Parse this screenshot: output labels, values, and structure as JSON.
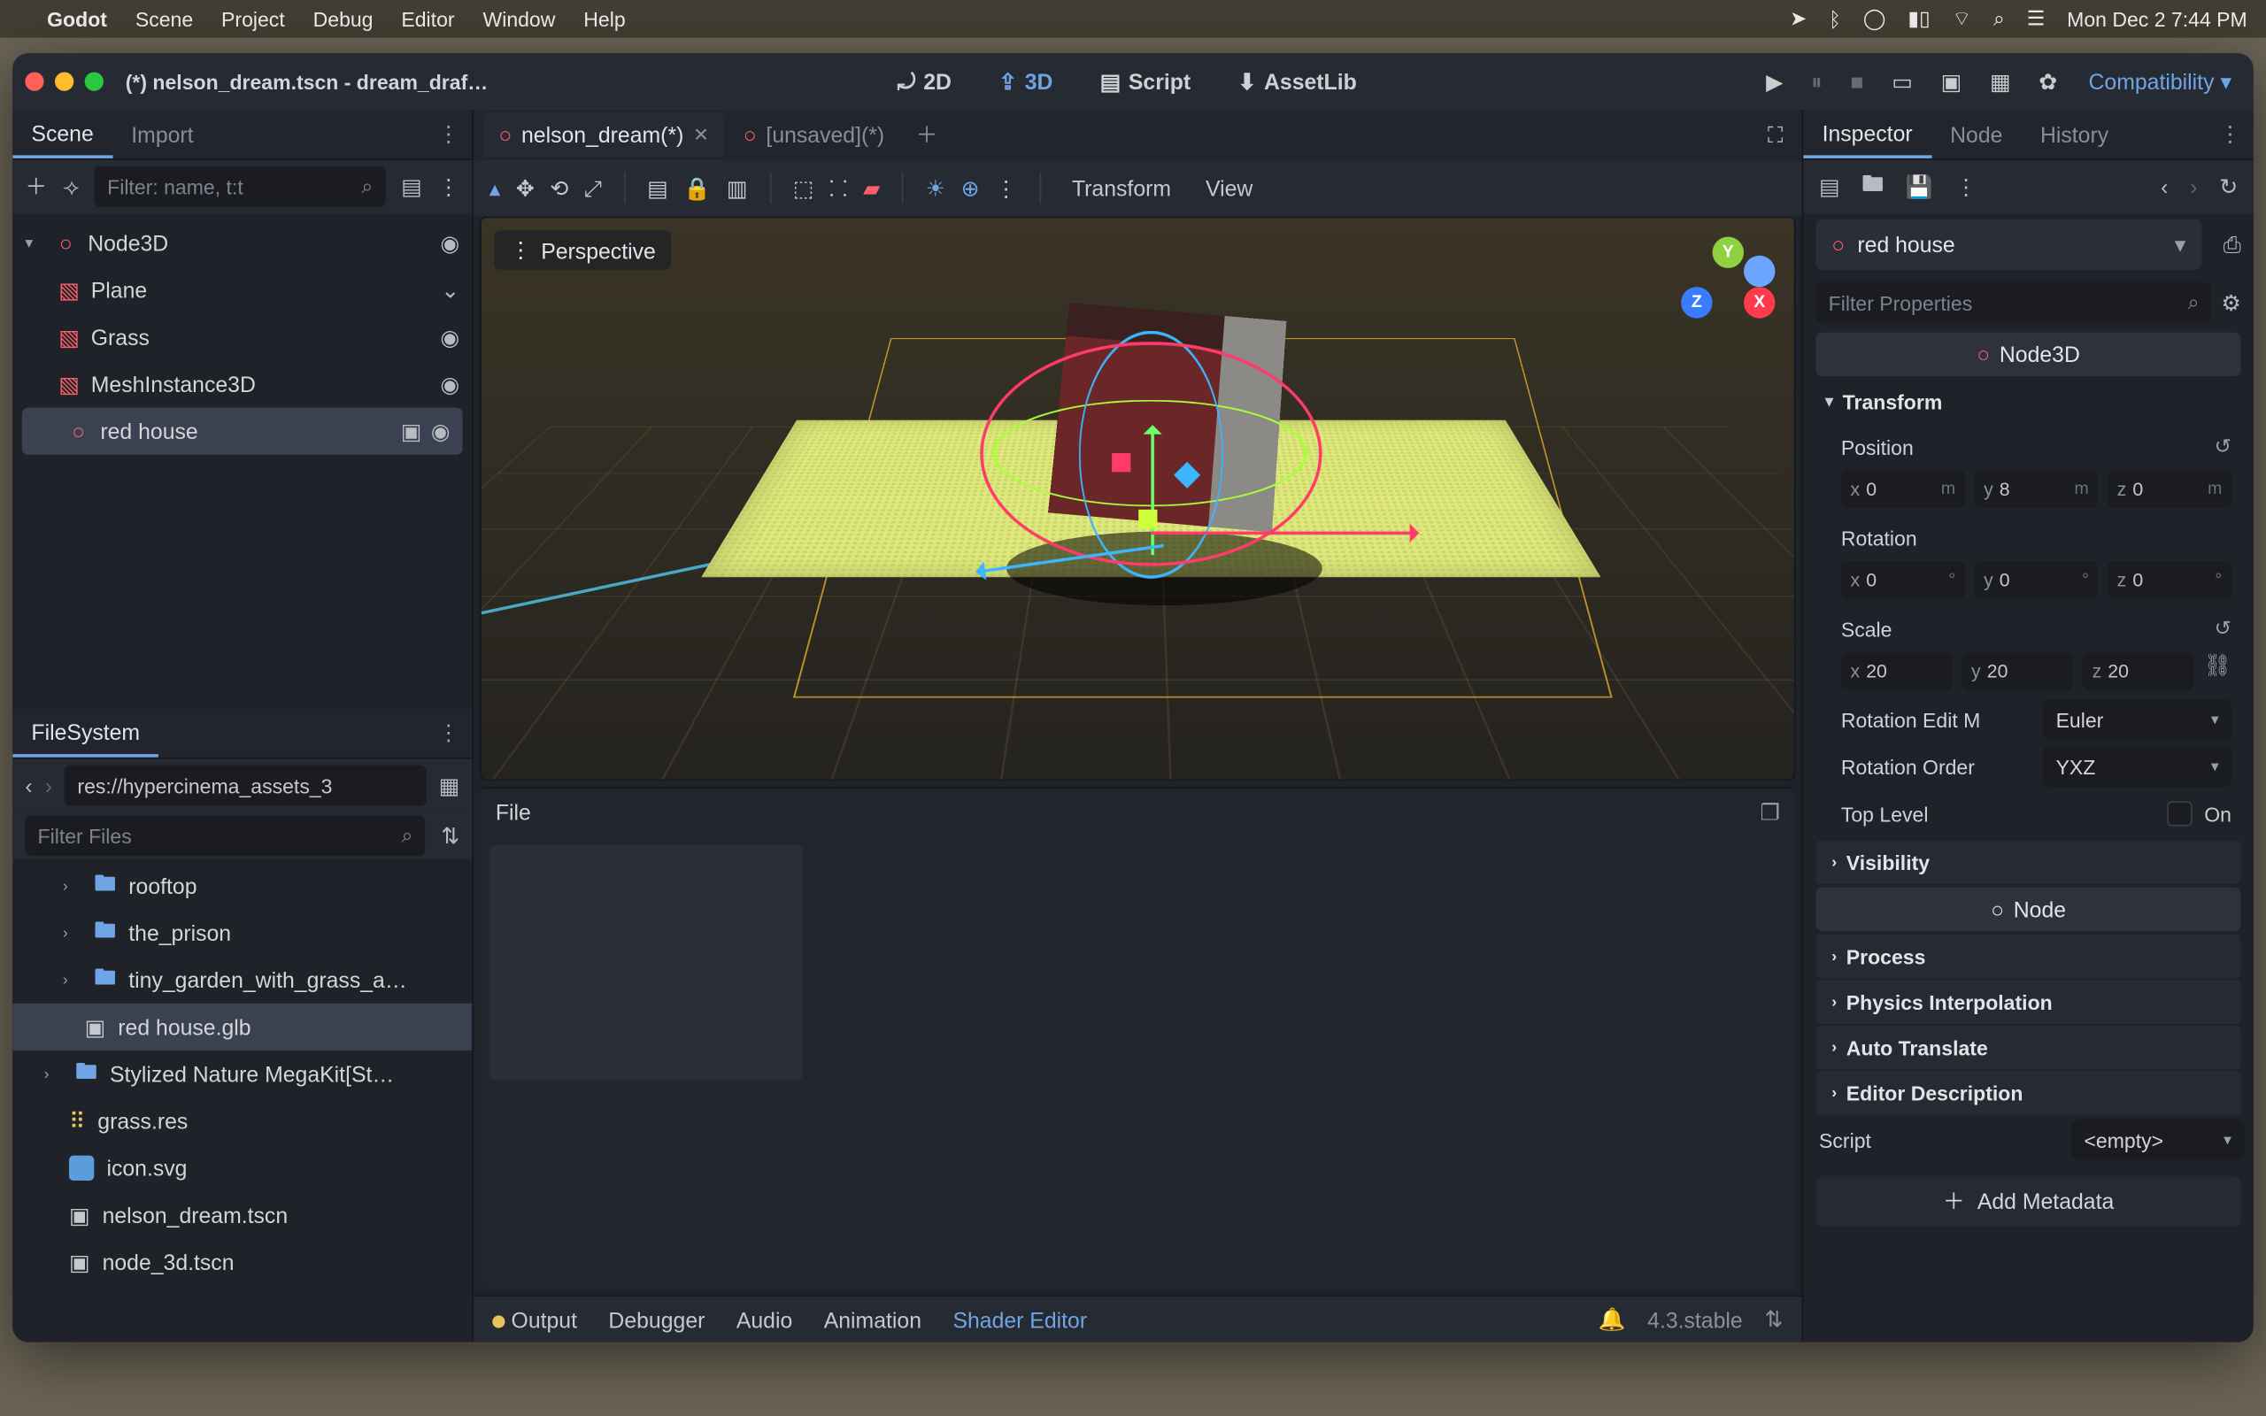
{
  "mac_menu": {
    "app": "Godot",
    "items": [
      "Scene",
      "Project",
      "Debug",
      "Editor",
      "Window",
      "Help"
    ],
    "status": "Mon Dec 2  7:44 PM"
  },
  "window": {
    "title": "(*) nelson_dream.tscn - dream_draf…",
    "workspaces": {
      "ws2d": "2D",
      "ws3d": "3D",
      "script": "Script",
      "assetlib": "AssetLib"
    },
    "renderer": "Compatibility"
  },
  "scene_panel": {
    "tabs": {
      "scene": "Scene",
      "import": "Import"
    },
    "filter_placeholder": "Filter: name, t:t",
    "tree": {
      "root": "Node3D",
      "items": [
        "Plane",
        "Grass",
        "MeshInstance3D",
        "red house"
      ]
    }
  },
  "scene_tabs": {
    "tab1": "nelson_dream(*)",
    "tab2": "[unsaved](*)"
  },
  "vp_toolbar": {
    "transform": "Transform",
    "view": "View"
  },
  "viewport": {
    "perspective": "Perspective"
  },
  "filesystem": {
    "title": "FileSystem",
    "path": "res://hypercinema_assets_3",
    "filter_placeholder": "Filter Files",
    "items": {
      "f0": "rooftop",
      "f1": "the_prison",
      "f2": "tiny_garden_with_grass_a…",
      "sel": "red house.glb",
      "f3": "Stylized Nature MegaKit[St…",
      "r0": "grass.res",
      "r1": "icon.svg",
      "s0": "nelson_dream.tscn",
      "s1": "node_3d.tscn"
    }
  },
  "file_panel": {
    "title": "File"
  },
  "statusbar": {
    "output": "Output",
    "debugger": "Debugger",
    "audio": "Audio",
    "animation": "Animation",
    "shader": "Shader Editor",
    "version": "4.3.stable"
  },
  "inspector": {
    "tabs": {
      "insp": "Inspector",
      "node": "Node",
      "history": "History"
    },
    "object": "red house",
    "filter_placeholder": "Filter Properties",
    "section_node3d": "Node3D",
    "transform": {
      "label": "Transform",
      "position": {
        "label": "Position",
        "x": "0",
        "y": "8",
        "z": "0",
        "unit": "m"
      },
      "rotation": {
        "label": "Rotation",
        "x": "0",
        "y": "0",
        "z": "0",
        "unit": "°"
      },
      "scale": {
        "label": "Scale",
        "x": "20",
        "y": "20",
        "z": "20"
      },
      "rot_edit_mode": {
        "label": "Rotation Edit M",
        "value": "Euler"
      },
      "rot_order": {
        "label": "Rotation Order",
        "value": "YXZ"
      },
      "top_level": {
        "label": "Top Level",
        "on": "On"
      }
    },
    "folds": {
      "visibility": "Visibility",
      "node_section": "Node",
      "process": "Process",
      "physics": "Physics Interpolation",
      "auto_translate": "Auto Translate",
      "editor_desc": "Editor Description"
    },
    "script": {
      "label": "Script",
      "value": "<empty>"
    },
    "add_metadata": "Add Metadata"
  }
}
